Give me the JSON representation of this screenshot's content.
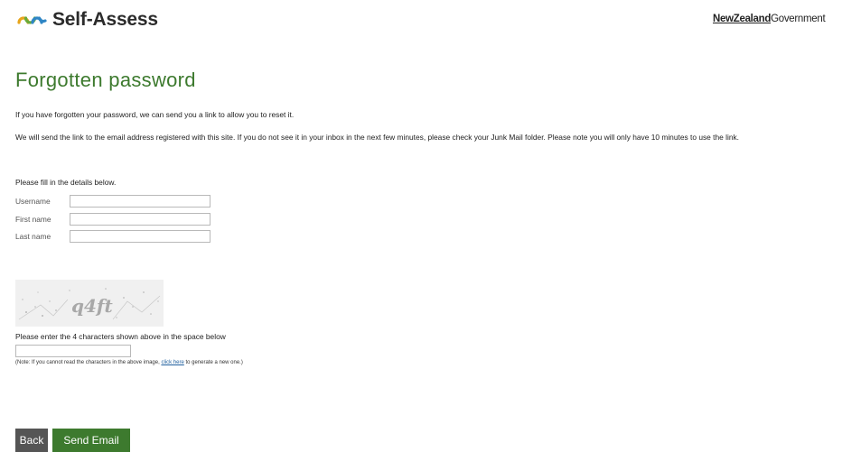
{
  "header": {
    "logo_text": "Self-Assess",
    "gov_strong": "NewZealand",
    "gov_rest": "Government"
  },
  "page_title": "Forgotten password",
  "intro": {
    "line1": "If you have forgotten your password, we can send you a link to allow you to reset it.",
    "line2": "We will send the link to the email address registered with this site. If you do not see it in your inbox in the next few minutes, please check your Junk Mail folder. Please note you will only have 10 minutes to use the link.",
    "line3": "Please fill in the details below."
  },
  "form": {
    "username_label": "Username",
    "username_value": "",
    "firstname_label": "First name",
    "firstname_value": "",
    "lastname_label": "Last name",
    "lastname_value": ""
  },
  "captcha": {
    "image_text": "q4ft",
    "instruction": "Please enter the 4 characters shown above in the space below",
    "value": "",
    "note_before": "(Note: If you cannot read the characters in the above image, ",
    "note_link": "click here",
    "note_after": " to generate a new one.)"
  },
  "buttons": {
    "back": "Back",
    "send": "Send Email"
  },
  "colors": {
    "brand_green": "#3d7a2e",
    "back_button": "#555555",
    "link": "#1f5f9e"
  }
}
